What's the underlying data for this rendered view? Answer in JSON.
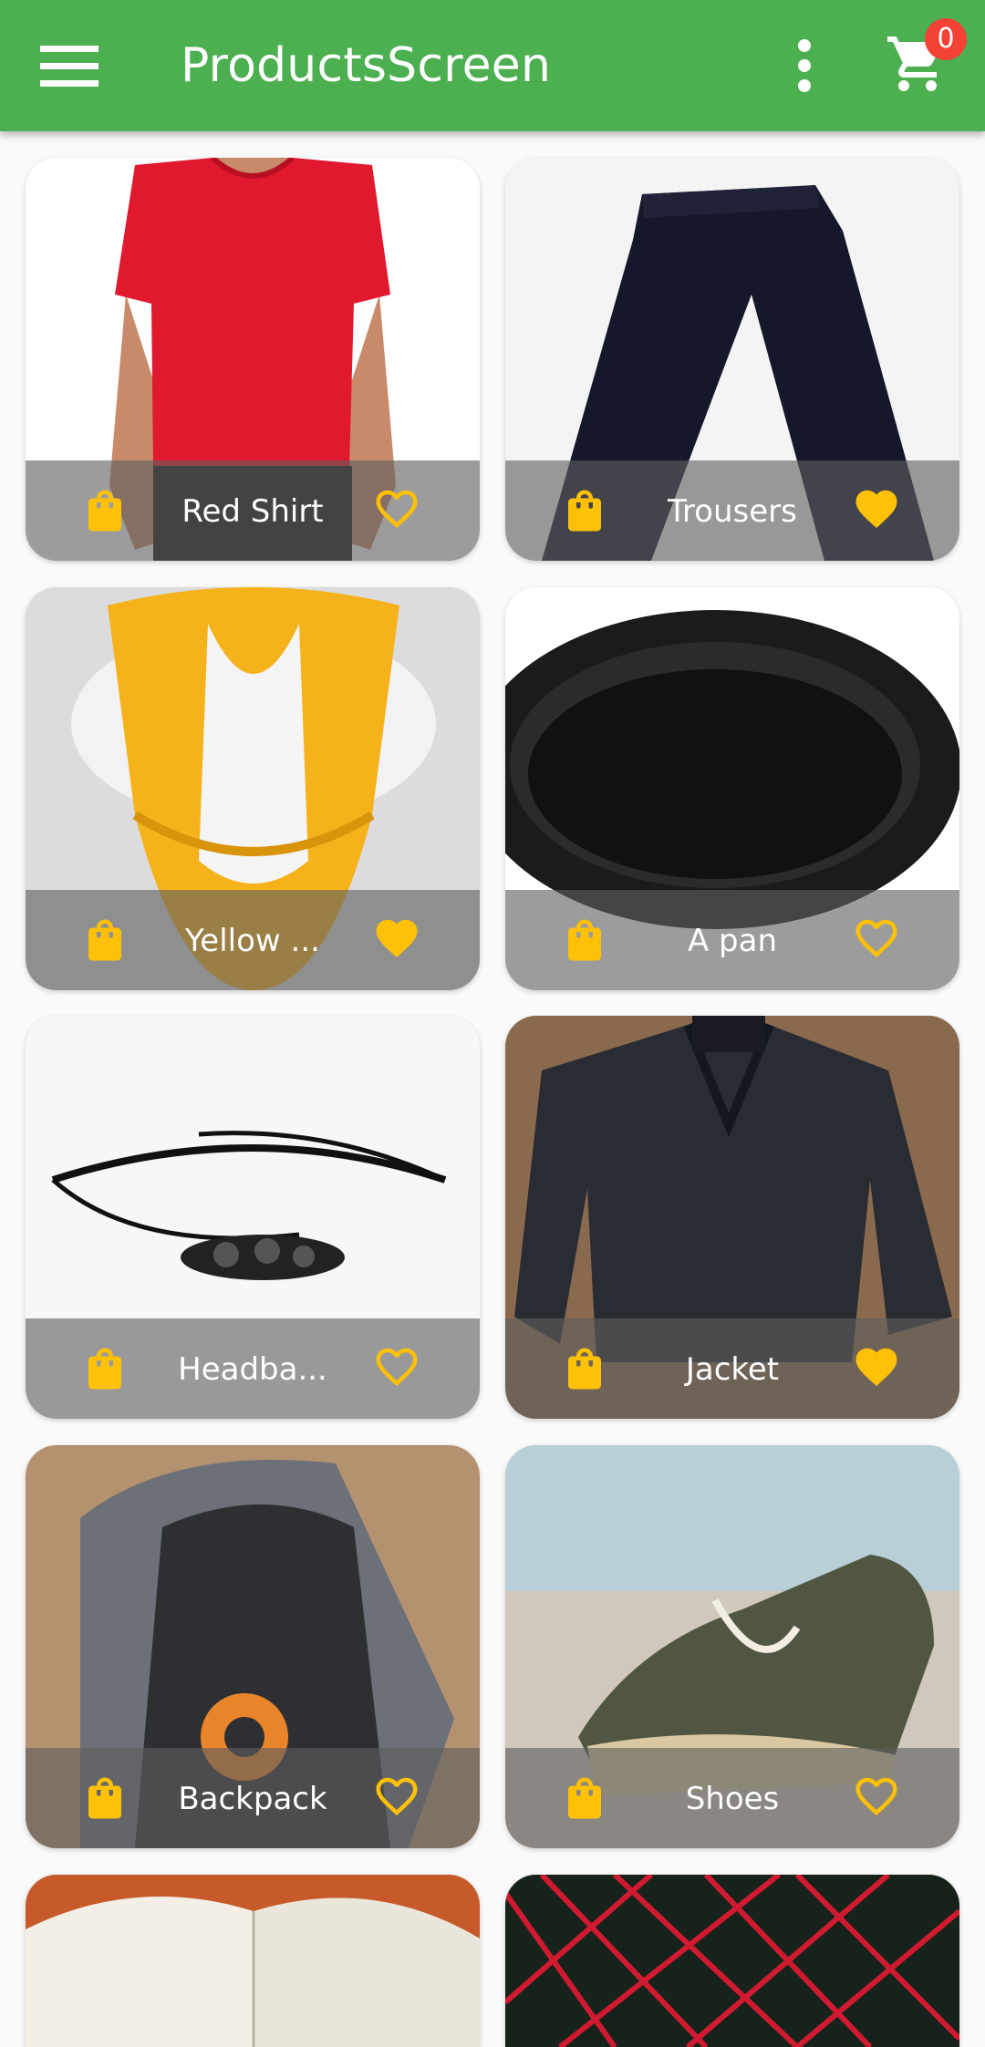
{
  "appbar": {
    "title": "ProductsScreen",
    "cart_count": "0"
  },
  "colors": {
    "primary": "#4caf50",
    "accent": "#ffc107",
    "badge": "#f44336"
  },
  "products": [
    {
      "name": "Red Shirt",
      "favorite": false,
      "image": "red-shirt-photo"
    },
    {
      "name": "Trousers",
      "favorite": true,
      "image": "trousers-photo"
    },
    {
      "name": "Yellow ...",
      "favorite": true,
      "image": "yellow-scarf-photo"
    },
    {
      "name": "A pan",
      "favorite": false,
      "image": "pan-photo"
    },
    {
      "name": "Headba...",
      "favorite": false,
      "image": "headband-photo"
    },
    {
      "name": "Jacket",
      "favorite": true,
      "image": "jacket-photo"
    },
    {
      "name": "Backpack",
      "favorite": false,
      "image": "backpack-photo"
    },
    {
      "name": "Shoes",
      "favorite": false,
      "image": "shoes-photo"
    }
  ],
  "icons": {
    "menu": "menu-icon",
    "more": "more-vert-icon",
    "cart": "shopping-cart-icon",
    "bag": "shopping-bag-icon",
    "favorite": "heart-icon"
  }
}
